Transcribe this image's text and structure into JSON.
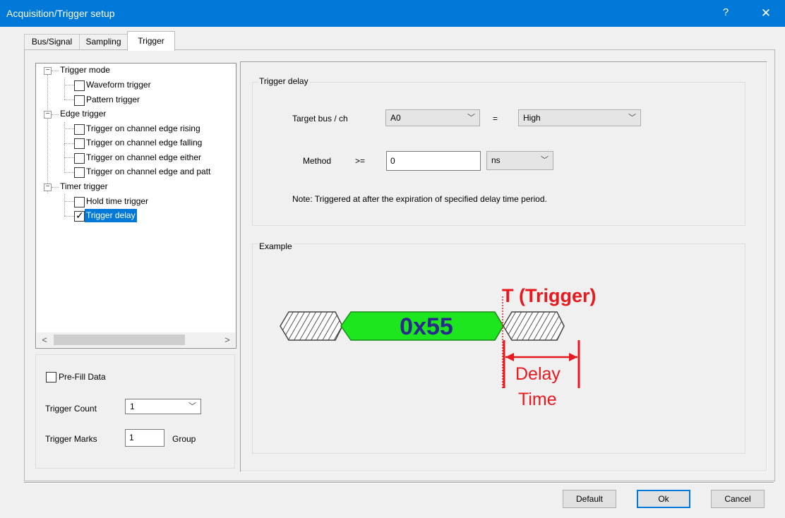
{
  "window": {
    "title": "Acquisition/Trigger setup",
    "help_glyph": "?",
    "close_glyph": "✕"
  },
  "tabs": [
    {
      "label": "Bus/Signal",
      "active": false
    },
    {
      "label": "Sampling",
      "active": false
    },
    {
      "label": "Trigger",
      "active": true
    }
  ],
  "tree": {
    "groups": [
      {
        "label": "Trigger mode",
        "expanded": true,
        "items": [
          {
            "label": "Waveform trigger",
            "checked": false
          },
          {
            "label": "Pattern trigger",
            "checked": false
          }
        ]
      },
      {
        "label": "Edge trigger",
        "expanded": true,
        "items": [
          {
            "label": "Trigger on channel edge rising",
            "checked": false
          },
          {
            "label": "Trigger on channel edge falling",
            "checked": false
          },
          {
            "label": "Trigger on channel edge either",
            "checked": false
          },
          {
            "label": "Trigger on channel edge and patt",
            "checked": false
          }
        ]
      },
      {
        "label": "Timer trigger",
        "expanded": true,
        "items": [
          {
            "label": "Hold time trigger",
            "checked": false
          },
          {
            "label": "Trigger delay",
            "checked": true,
            "selected": true
          }
        ]
      }
    ],
    "scroll_left": "<",
    "scroll_right": ">"
  },
  "options": {
    "prefill_label": "Pre-Fill Data",
    "prefill_checked": false,
    "trigger_count_label": "Trigger Count",
    "trigger_count_value": "1",
    "trigger_marks_label": "Trigger Marks",
    "trigger_marks_value": "1",
    "trigger_marks_unit": "Group"
  },
  "trigger_delay": {
    "legend": "Trigger delay",
    "target_label": "Target bus / ch",
    "target_value": "A0",
    "equals": "=",
    "level_value": "High",
    "method_label": "Method",
    "method_op": ">=",
    "delay_value": "0",
    "unit_value": "ns",
    "note": "Note: Triggered at after the expiration of specified delay time period."
  },
  "example": {
    "legend": "Example",
    "data_value": "0x55",
    "trigger_label": "T (Trigger)",
    "delay_label_1": "Delay",
    "delay_label_2": "Time",
    "colors": {
      "data": "#1ee61e",
      "data_text": "#2a2a8c",
      "trigger": "#e8191e"
    }
  },
  "buttons": {
    "default": "Default",
    "ok": "Ok",
    "cancel": "Cancel"
  }
}
